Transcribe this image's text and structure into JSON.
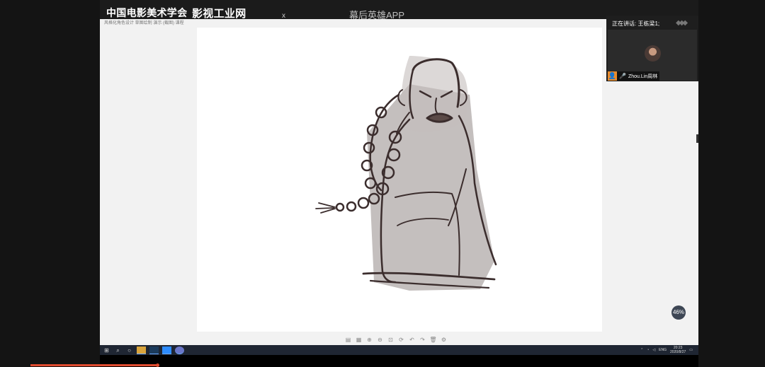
{
  "banner": {
    "org": "中国电影美术学会",
    "x": "x",
    "brand": "影视工业网",
    "app": "幕后英雄APP"
  },
  "document": {
    "info_line": "风格化角色设计 草图绘制 演示 (截图) 课程"
  },
  "canvas_toolbar": {
    "icons": [
      "document-icon",
      "grid-icon",
      "zoom-in-icon",
      "zoom-out-icon",
      "fit-icon",
      "rotate-icon",
      "undo-icon",
      "redo-icon",
      "delete-icon",
      "settings-icon"
    ],
    "glyphs": [
      "▤",
      "▦",
      "⊕",
      "⊖",
      "⊡",
      "⟳",
      "↶",
      "↷",
      "🗑",
      "⚙"
    ]
  },
  "zoom_badge": "46%",
  "video_panel": {
    "speaking_label": "正在讲话: 王栋梁1;",
    "participant_name": "Zhou.Lin周林",
    "user_icon_glyph": "👤",
    "mic_glyph": "🎤"
  },
  "taskbar": {
    "left_glyphs": [
      "⊞",
      "⌕",
      "○"
    ],
    "apps": [
      "file-explorer-icon",
      "photoshop-icon",
      "zoom-icon",
      "meeting-icon"
    ],
    "lang": "ENG",
    "time": "20:23",
    "date": "2020/8/27"
  },
  "colors": {
    "banner_bg": "#1b1b1b",
    "desktop_bg": "#f2f2f2",
    "taskbar_bg": "#1f2633",
    "progress": "#e04b2f",
    "avatar_orange": "#e88b2d"
  }
}
